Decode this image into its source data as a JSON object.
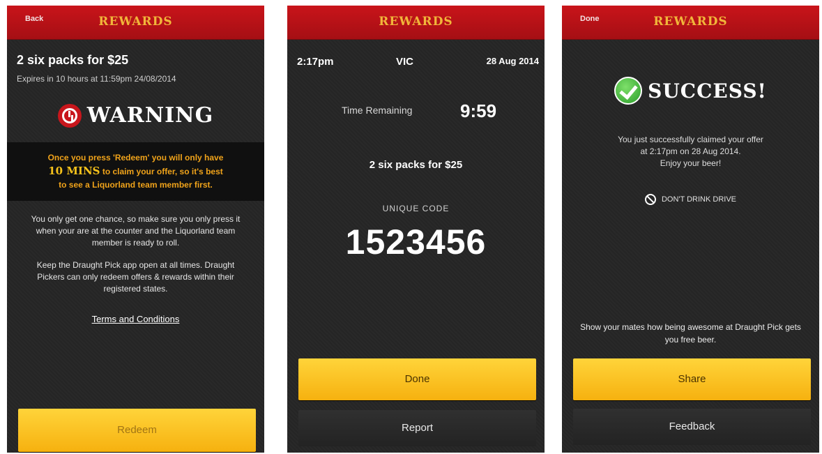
{
  "screen1": {
    "nav_button": "Back",
    "title": "REWARDS",
    "offer_title": "2 six packs for $25",
    "offer_expiry": "Expires in 10 hours at 11:59pm 24/08/2014",
    "warning_title": "WARNING",
    "warning_line1": "Once you press 'Redeem' you will only have",
    "warning_mins": "10 MINS",
    "warning_line2": "to claim your offer, so it's best",
    "warning_line3": "to see a Liquorland team member first.",
    "paragraph1": "You only get one chance, so make sure you only press it when your are at the counter and the Liquorland team member is ready to roll.",
    "paragraph2": "Keep the Draught Pick app open at all times. Draught Pickers can only redeem offers & rewards within their registered states.",
    "terms_link": "Terms and Conditions",
    "redeem_button": "Redeem"
  },
  "screen2": {
    "title": "REWARDS",
    "time": "2:17pm",
    "state": "VIC",
    "date": "28 Aug 2014",
    "time_remaining_label": "Time Remaining",
    "time_remaining_value": "9:59",
    "offer_title": "2 six packs for $25",
    "code_label": "UNIQUE CODE",
    "code_value": "1523456",
    "done_button": "Done",
    "report_button": "Report"
  },
  "screen3": {
    "nav_button": "Done",
    "title": "REWARDS",
    "success_title": "SUCCESS!",
    "message_line1": "You just successfully claimed your offer",
    "message_line2": "at 2:17pm on 28 Aug 2014.",
    "message_line3": "Enjoy your beer!",
    "notice": "DON'T DRINK DRIVE",
    "share_prompt": "Show your mates how being awesome at Draught Pick gets you free beer.",
    "share_button": "Share",
    "feedback_button": "Feedback"
  }
}
